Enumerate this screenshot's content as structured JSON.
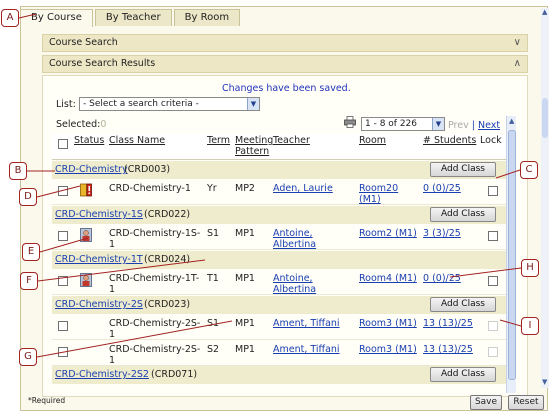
{
  "tabs": [
    "By Course",
    "By Teacher",
    "By Room"
  ],
  "panels": {
    "search": "Course Search",
    "results": "Course Search Results"
  },
  "message": "Changes have been saved.",
  "list": {
    "label": "List:",
    "value": "- Select a search criteria -"
  },
  "selected": {
    "label": "Selected:",
    "count": "0"
  },
  "pager": {
    "range": "1 - 8 of 226",
    "prev": "Prev",
    "sep": "|",
    "next": "Next"
  },
  "columns": {
    "status": "Status",
    "class_name": "Class Name",
    "term": "Term",
    "meeting": "Meeting",
    "pattern": "Pattern",
    "teacher": "Teacher",
    "room": "Room",
    "students": "# Students",
    "lock": "Lock"
  },
  "add_class_label": "Add Class",
  "groups": [
    {
      "name": "CRD-Chemistry",
      "code": "(CRD003)"
    },
    {
      "name": "CRD-Chemistry-1S",
      "code": "(CRD022)"
    },
    {
      "name": "CRD-Chemistry-1T",
      "code": "(CRD024)"
    },
    {
      "name": "CRD-Chemistry-2S",
      "code": "(CRD023)"
    },
    {
      "name": "CRD-Chemistry-2S2",
      "code": "(CRD071)"
    }
  ],
  "rows": [
    {
      "class1": "CRD-Chemistry-1",
      "class2": "",
      "term": "Yr",
      "meeting": "MP2",
      "teacher1": "Aden, Laurie",
      "teacher2": "",
      "room1": "Room20",
      "room2": "(M1)",
      "students": "0 (0)/25",
      "status_icon": "warning-status-icon"
    },
    {
      "class1": "CRD-Chemistry-1S-",
      "class2": "1",
      "term": "S1",
      "meeting": "MP1",
      "teacher1": "Antoine,",
      "teacher2": "Albertina",
      "room1": "Room2 (M1)",
      "room2": "",
      "students": "3 (3)/25",
      "status_icon": "teacher-status-icon"
    },
    {
      "class1": "CRD-Chemistry-1T-",
      "class2": "1",
      "term": "T1",
      "meeting": "MP1",
      "teacher1": "Antoine,",
      "teacher2": "Albertina",
      "room1": "Room4 (M1)",
      "room2": "",
      "students": "0 (0)/25",
      "status_icon": "teacher-status-icon"
    },
    {
      "class1": "CRD-Chemistry-2S-",
      "class2": "1",
      "term": "S1",
      "meeting": "MP1",
      "teacher1": "Ament, Tiffani",
      "teacher2": "",
      "room1": "Room3 (M1)",
      "room2": "",
      "students": "13 (13)/25",
      "status_icon": ""
    },
    {
      "class1": "CRD-Chemistry-2S-",
      "class2": "1",
      "term": "S2",
      "meeting": "MP1",
      "teacher1": "Ament, Tiffani",
      "teacher2": "",
      "room1": "Room3 (M1)",
      "room2": "",
      "students": "13 (13)/25",
      "status_icon": ""
    }
  ],
  "footer": {
    "required": "*Required",
    "save": "Save",
    "reset": "Reset"
  },
  "callouts": [
    "A",
    "B",
    "C",
    "D",
    "E",
    "F",
    "G",
    "H",
    "I"
  ],
  "colors": {
    "link": "#1a3fb0",
    "message": "#2233bb",
    "group_bg": "#efeccd",
    "callout_border": "#a32222"
  }
}
